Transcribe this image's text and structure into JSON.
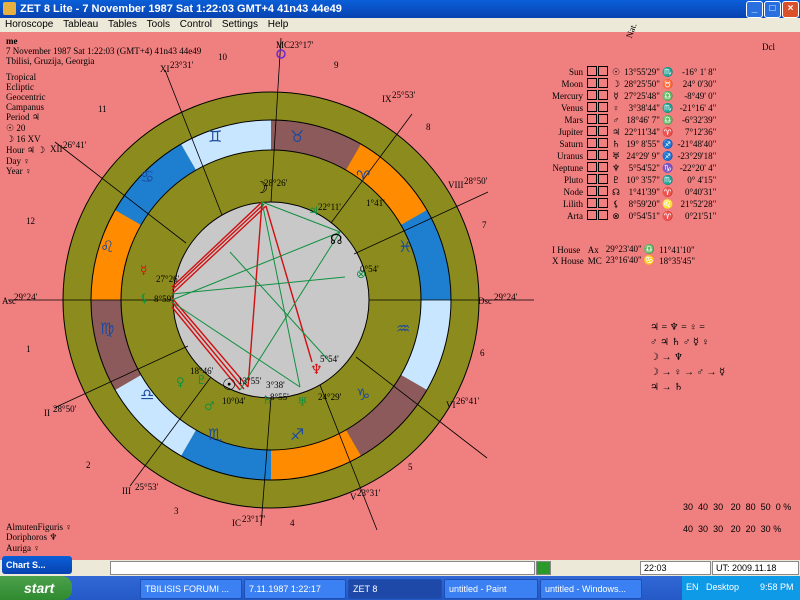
{
  "window": {
    "title": "ZET 8 Lite - 7 November 1987  Sat   1:22:03 GMT+4 41n43  44e49"
  },
  "menu": [
    "Horoscope",
    "Tableau",
    "Tables",
    "Tools",
    "Control",
    "Settings",
    "Help"
  ],
  "chart_info": {
    "name": "me",
    "datetime": "7 November 1987  Sat   1:22:03 (GMT+4) 41n43  44e49",
    "place": "Tbilisi, Gruzija, Georgia",
    "settings": [
      "Tropical",
      "Ecliptic",
      "Geocentric",
      "Campanus"
    ],
    "period": "Period ♃",
    "sun_num": "☉  20",
    "moon_line": "☽  16 XV",
    "hour": "Hour ♃ ☽",
    "day": "Day ♀",
    "year": "Year ♀"
  },
  "left_bottom": {
    "almuten": "AlmutenFiguris   ♀",
    "doriphoros": "Doriphoros    ♆",
    "auriga": "Auriga   ♀"
  },
  "wheel": {
    "mc": "MC",
    "mc_deg": "23°17'",
    "ic": "IC",
    "ic_deg": "23°17'",
    "asc": "Asc",
    "asc_deg": "29°24'",
    "dsc": "Dsc",
    "dsc_deg": "29°24'",
    "cusps": [
      {
        "roman": "XI",
        "deg": "23°31'"
      },
      {
        "roman": "XII",
        "deg": "26°41'"
      },
      {
        "roman": "II",
        "deg": "28°50'"
      },
      {
        "roman": "III",
        "deg": "25°53'"
      },
      {
        "roman": "V",
        "deg": "23°31'"
      },
      {
        "roman": "VI",
        "deg": "26°41'"
      },
      {
        "roman": "VIII",
        "deg": "28°50'"
      },
      {
        "roman": "IX",
        "deg": "25°53'"
      }
    ],
    "house_numbers": [
      "10",
      "11",
      "12",
      "1",
      "2",
      "3",
      "4",
      "5",
      "6",
      "7",
      "8",
      "9"
    ],
    "planet_labels": [
      "28°26'",
      "10°04'",
      "13°55'",
      "3°38'",
      "27°26'",
      "22°11'",
      "8°55'",
      "5°54'",
      "24°29'",
      "1°41'",
      "18°46'",
      "8°59'",
      "0°54'"
    ]
  },
  "aspect_table_header": [
    "Nat.",
    "Dcl"
  ],
  "planets": [
    {
      "name": "Sun",
      "glyph": "☉",
      "pos": "13°55'29\" ♏",
      "dcl": "-16° 1' 8\""
    },
    {
      "name": "Moon",
      "glyph": "☽",
      "pos": "28°25'50\" ♉",
      "dcl": "24° 0'30\""
    },
    {
      "name": "Mercury",
      "glyph": "☿",
      "pos": "27°25'48\" ♎",
      "dcl": "-8°49' 0\""
    },
    {
      "name": "Venus",
      "glyph": "♀",
      "pos": "3°38'44\" ♏",
      "dcl": "-21°16' 4\""
    },
    {
      "name": "Mars",
      "glyph": "♂",
      "pos": "18°46' 7\" ♎",
      "dcl": "-6°32'39\""
    },
    {
      "name": "Jupiter",
      "glyph": "♃",
      "pos": "22°11'34\" ♈",
      "dcl": "7°12'36\""
    },
    {
      "name": "Saturn",
      "glyph": "♄",
      "pos": "19° 8'55\" ♐",
      "dcl": "-21°48'40\""
    },
    {
      "name": "Uranus",
      "glyph": "♅",
      "pos": "24°29' 9\" ♐",
      "dcl": "-23°29'18\""
    },
    {
      "name": "Neptune",
      "glyph": "♆",
      "pos": "5°54'52\" ♑",
      "dcl": "-22°20' 4\""
    },
    {
      "name": "Pluto",
      "glyph": "♇",
      "pos": "10° 3'57\" ♏",
      "dcl": "0° 4'15\""
    },
    {
      "name": "Node",
      "glyph": "☊",
      "pos": "1°41'39\" ♈",
      "dcl": "0°40'31\""
    },
    {
      "name": "Lilith",
      "glyph": "⚸",
      "pos": "8°59'20\" ♌",
      "dcl": "21°52'28\""
    },
    {
      "name": "Arta",
      "glyph": "⊗",
      "pos": "0°54'51\" ♈",
      "dcl": "0°21'51\""
    }
  ],
  "houses_table": [
    {
      "name": "I House",
      "code": "Ax",
      "pos": "29°23'40\" ♎",
      "dcl": "11°41'10\""
    },
    {
      "name": "X House",
      "code": "MC",
      "pos": "23°16'40\" ♋",
      "dcl": "18°35'45\""
    }
  ],
  "rulers": [
    "♃ = ♆ = ♀ =",
    "♂ ♃ ♄ ♂ ☿ ♀",
    "☽ → ♆",
    "☽ → ♀ → ♂ → ☿",
    "♃ → ♄"
  ],
  "elements": {
    "row1": [
      "30",
      "40",
      "30",
      "20",
      "80",
      "50",
      "0",
      "%"
    ],
    "row2": [
      "40",
      "30",
      "30",
      "20",
      "20",
      "30",
      "%"
    ]
  },
  "statusbar": {
    "time": "22:03",
    "ut": "UT: 2009.11.18 18:58:41"
  },
  "chart_window": "Chart S...",
  "taskbar": {
    "start": "start",
    "tasks": [
      "TBILISIS FORUMI ...",
      "7.11.1987   1:22:17",
      "ZET 8",
      "untitled - Paint",
      "untitled - Windows..."
    ],
    "lang": "EN",
    "desktop": "Desktop",
    "clock": "9:58 PM"
  },
  "colors": {
    "background": "#f08080",
    "ring": "#8c8c1e",
    "fire": "#ff8c00",
    "water": "#1e7fd0",
    "air": "#c8e6ff",
    "earth": "#8c5a5a"
  }
}
